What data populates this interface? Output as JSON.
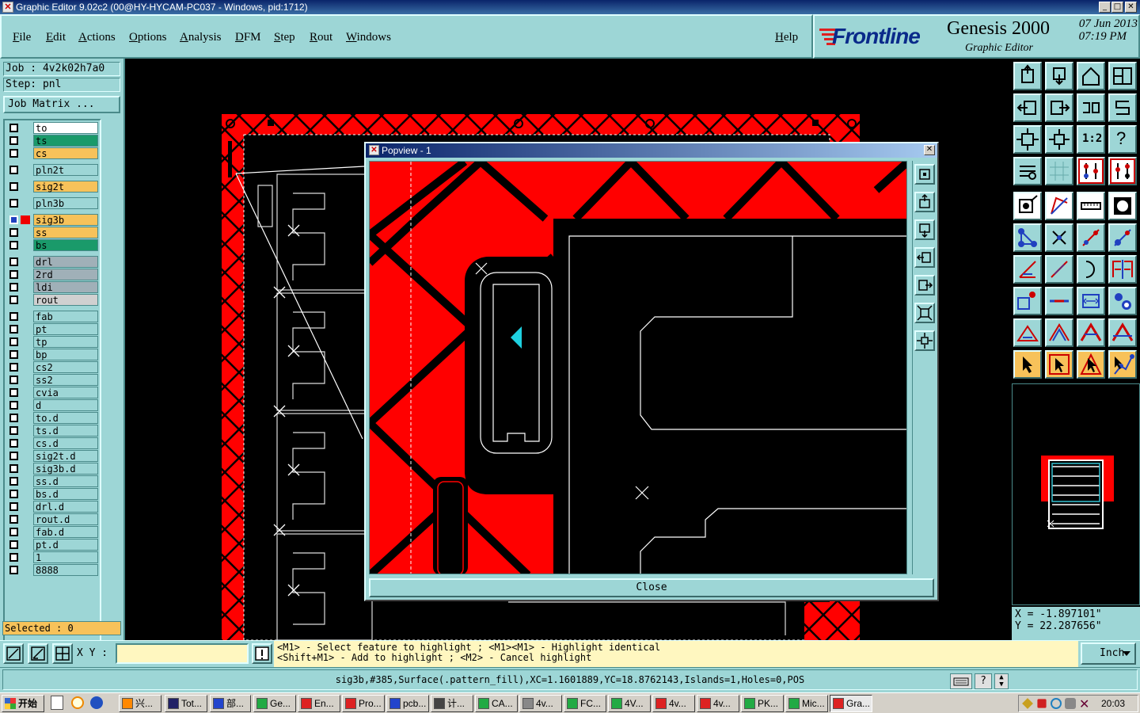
{
  "window": {
    "title": "Graphic Editor 9.02c2 (00@HY-HYCAM-PC037 - Windows, pid:1712)"
  },
  "menu": {
    "file": "File",
    "edit": "Edit",
    "actions": "Actions",
    "options": "Options",
    "analysis": "Analysis",
    "dfm": "DFM",
    "step": "Step",
    "rout": "Rout",
    "windows": "Windows",
    "help": "Help"
  },
  "brand": {
    "logo": "Frontline",
    "product": "Genesis 2000",
    "subtitle": "Graphic Editor",
    "date": "07 Jun 2013",
    "time": "07:19 PM"
  },
  "left": {
    "job": "Job : 4v2k02h7a0",
    "step": "Step: pnl",
    "job_matrix": "Job Matrix ...",
    "selected": "Selected : 0",
    "layers": [
      {
        "name": "to",
        "color": "#ffffff"
      },
      {
        "name": "ts",
        "color": "#1a9a6a"
      },
      {
        "name": "cs",
        "color": "#f7c25a"
      },
      {
        "name": "pln2t",
        "color": "#9dd6d6"
      },
      {
        "name": "sig2t",
        "color": "#f7c25a"
      },
      {
        "name": "pln3b",
        "color": "#9dd6d6"
      },
      {
        "name": "sig3b",
        "color": "#f7c25a"
      },
      {
        "name": "ss",
        "color": "#f7c25a"
      },
      {
        "name": "bs",
        "color": "#1a9a6a"
      },
      {
        "name": "drl",
        "color": "#a0b0b8"
      },
      {
        "name": "2rd",
        "color": "#a0b0b8"
      },
      {
        "name": "ldi",
        "color": "#a0b0b8"
      },
      {
        "name": "rout",
        "color": "#d0d0d0"
      },
      {
        "name": "fab",
        "color": "#9dd6d6"
      },
      {
        "name": "pt",
        "color": "#9dd6d6"
      },
      {
        "name": "tp",
        "color": "#9dd6d6"
      },
      {
        "name": "bp",
        "color": "#9dd6d6"
      },
      {
        "name": "cs2",
        "color": "#9dd6d6"
      },
      {
        "name": "ss2",
        "color": "#9dd6d6"
      },
      {
        "name": "cvia",
        "color": "#9dd6d6"
      },
      {
        "name": "d",
        "color": "#9dd6d6"
      },
      {
        "name": "to.d",
        "color": "#9dd6d6"
      },
      {
        "name": "ts.d",
        "color": "#9dd6d6"
      },
      {
        "name": "cs.d",
        "color": "#9dd6d6"
      },
      {
        "name": "sig2t.d",
        "color": "#9dd6d6"
      },
      {
        "name": "sig3b.d",
        "color": "#9dd6d6"
      },
      {
        "name": "ss.d",
        "color": "#9dd6d6"
      },
      {
        "name": "bs.d",
        "color": "#9dd6d6"
      },
      {
        "name": "drl.d",
        "color": "#9dd6d6"
      },
      {
        "name": "rout.d",
        "color": "#9dd6d6"
      },
      {
        "name": "fab.d",
        "color": "#9dd6d6"
      },
      {
        "name": "pt.d",
        "color": "#9dd6d6"
      },
      {
        "name": "1",
        "color": "#9dd6d6"
      },
      {
        "name": "8888",
        "color": "#9dd6d6"
      }
    ]
  },
  "popview": {
    "title": "Popview - 1",
    "close": "Close"
  },
  "coords": {
    "x": "X = -1.897101\"",
    "y": "Y = 22.287656\""
  },
  "command": {
    "xy_label": "X Y :",
    "hint_line1": "<M1> - Select feature to highlight ; <M1><M1> - Highlight identical",
    "hint_line2": "<Shift+M1> - Add to highlight ; <M2> - Cancel highlight",
    "unit": "Inch"
  },
  "status": {
    "text": "sig3b,#385,Surface(.pattern_fill),XC=1.1601889,YC=18.8762143,Islands=1,Holes=0,POS"
  },
  "taskbar": {
    "start": "开始",
    "tasks": [
      "兴...",
      "Tot...",
      "部...",
      "Ge...",
      "En...",
      "Pro...",
      "pcb...",
      "计...",
      "CA...",
      "4v...",
      "FC...",
      "4V...",
      "4v...",
      "4v...",
      "PK...",
      "Mic...",
      "Gra..."
    ],
    "clock": "20:03"
  },
  "colors": {
    "panel": "#9dd6d6",
    "copper": "#ff0000",
    "highlight": "#f7c25a"
  }
}
